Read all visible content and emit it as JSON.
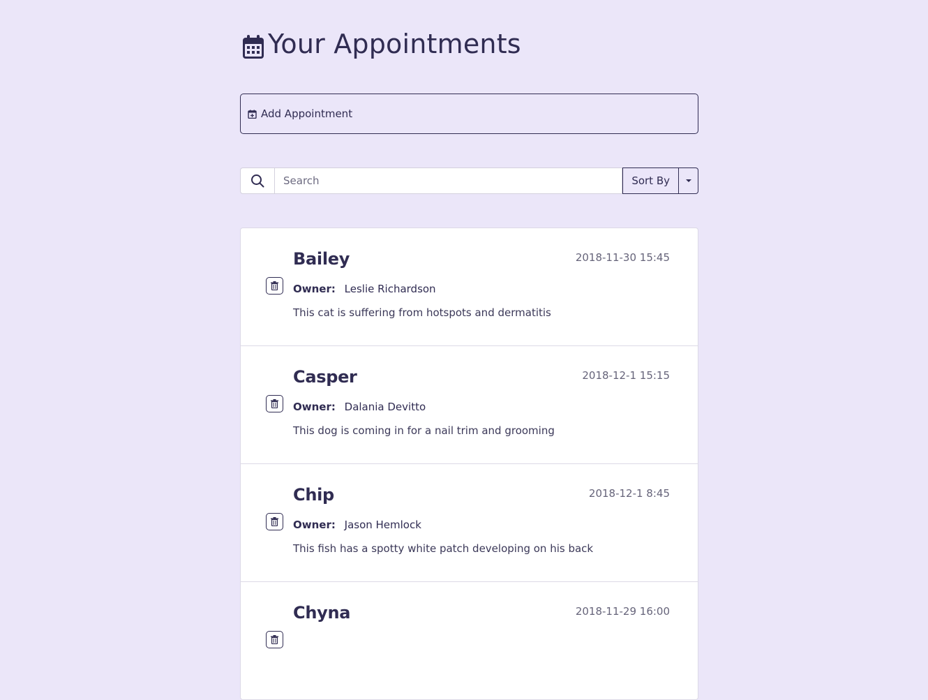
{
  "header": {
    "title": "Your Appointments",
    "icon": "calendar-icon"
  },
  "add_appointment": {
    "label": "Add Appointment",
    "icon": "calendar-plus-icon"
  },
  "search": {
    "placeholder": "Search",
    "value": "",
    "icon": "search-icon"
  },
  "sort": {
    "label": "Sort By"
  },
  "appointments": [
    {
      "pet_name": "Bailey",
      "date": "2018-11-30 15:45",
      "owner_label": "Owner:",
      "owner_name": "Leslie Richardson",
      "notes": "This cat is suffering from hotspots and dermatitis"
    },
    {
      "pet_name": "Casper",
      "date": "2018-12-1 15:15",
      "owner_label": "Owner:",
      "owner_name": "Dalania Devitto",
      "notes": "This dog is coming in for a nail trim and grooming"
    },
    {
      "pet_name": "Chip",
      "date": "2018-12-1 8:45",
      "owner_label": "Owner:",
      "owner_name": "Jason Hemlock",
      "notes": "This fish has a spotty white patch developing on his back"
    },
    {
      "pet_name": "Chyna",
      "date": "2018-11-29 16:00",
      "owner_label": "",
      "owner_name": "",
      "notes": ""
    }
  ],
  "colors": {
    "background": "#ebe6f9",
    "primary": "#302c52",
    "card": "#ffffff",
    "muted": "#66647a"
  }
}
